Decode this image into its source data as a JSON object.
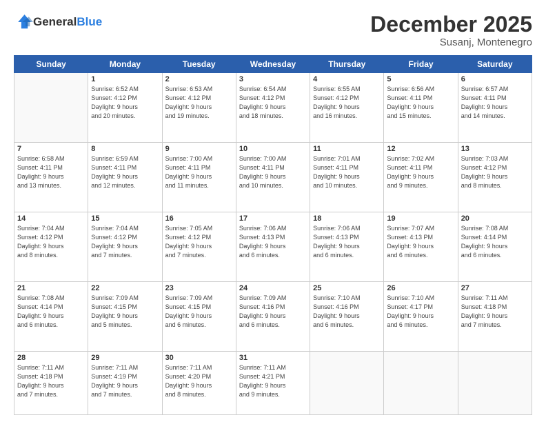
{
  "header": {
    "logo_general": "General",
    "logo_blue": "Blue",
    "month_year": "December 2025",
    "location": "Susanj, Montenegro"
  },
  "days_of_week": [
    "Sunday",
    "Monday",
    "Tuesday",
    "Wednesday",
    "Thursday",
    "Friday",
    "Saturday"
  ],
  "weeks": [
    [
      {
        "day": "",
        "info": ""
      },
      {
        "day": "1",
        "info": "Sunrise: 6:52 AM\nSunset: 4:12 PM\nDaylight: 9 hours\nand 20 minutes."
      },
      {
        "day": "2",
        "info": "Sunrise: 6:53 AM\nSunset: 4:12 PM\nDaylight: 9 hours\nand 19 minutes."
      },
      {
        "day": "3",
        "info": "Sunrise: 6:54 AM\nSunset: 4:12 PM\nDaylight: 9 hours\nand 18 minutes."
      },
      {
        "day": "4",
        "info": "Sunrise: 6:55 AM\nSunset: 4:12 PM\nDaylight: 9 hours\nand 16 minutes."
      },
      {
        "day": "5",
        "info": "Sunrise: 6:56 AM\nSunset: 4:11 PM\nDaylight: 9 hours\nand 15 minutes."
      },
      {
        "day": "6",
        "info": "Sunrise: 6:57 AM\nSunset: 4:11 PM\nDaylight: 9 hours\nand 14 minutes."
      }
    ],
    [
      {
        "day": "7",
        "info": "Sunrise: 6:58 AM\nSunset: 4:11 PM\nDaylight: 9 hours\nand 13 minutes."
      },
      {
        "day": "8",
        "info": "Sunrise: 6:59 AM\nSunset: 4:11 PM\nDaylight: 9 hours\nand 12 minutes."
      },
      {
        "day": "9",
        "info": "Sunrise: 7:00 AM\nSunset: 4:11 PM\nDaylight: 9 hours\nand 11 minutes."
      },
      {
        "day": "10",
        "info": "Sunrise: 7:00 AM\nSunset: 4:11 PM\nDaylight: 9 hours\nand 10 minutes."
      },
      {
        "day": "11",
        "info": "Sunrise: 7:01 AM\nSunset: 4:11 PM\nDaylight: 9 hours\nand 10 minutes."
      },
      {
        "day": "12",
        "info": "Sunrise: 7:02 AM\nSunset: 4:11 PM\nDaylight: 9 hours\nand 9 minutes."
      },
      {
        "day": "13",
        "info": "Sunrise: 7:03 AM\nSunset: 4:12 PM\nDaylight: 9 hours\nand 8 minutes."
      }
    ],
    [
      {
        "day": "14",
        "info": "Sunrise: 7:04 AM\nSunset: 4:12 PM\nDaylight: 9 hours\nand 8 minutes."
      },
      {
        "day": "15",
        "info": "Sunrise: 7:04 AM\nSunset: 4:12 PM\nDaylight: 9 hours\nand 7 minutes."
      },
      {
        "day": "16",
        "info": "Sunrise: 7:05 AM\nSunset: 4:12 PM\nDaylight: 9 hours\nand 7 minutes."
      },
      {
        "day": "17",
        "info": "Sunrise: 7:06 AM\nSunset: 4:13 PM\nDaylight: 9 hours\nand 6 minutes."
      },
      {
        "day": "18",
        "info": "Sunrise: 7:06 AM\nSunset: 4:13 PM\nDaylight: 9 hours\nand 6 minutes."
      },
      {
        "day": "19",
        "info": "Sunrise: 7:07 AM\nSunset: 4:13 PM\nDaylight: 9 hours\nand 6 minutes."
      },
      {
        "day": "20",
        "info": "Sunrise: 7:08 AM\nSunset: 4:14 PM\nDaylight: 9 hours\nand 6 minutes."
      }
    ],
    [
      {
        "day": "21",
        "info": "Sunrise: 7:08 AM\nSunset: 4:14 PM\nDaylight: 9 hours\nand 6 minutes."
      },
      {
        "day": "22",
        "info": "Sunrise: 7:09 AM\nSunset: 4:15 PM\nDaylight: 9 hours\nand 5 minutes."
      },
      {
        "day": "23",
        "info": "Sunrise: 7:09 AM\nSunset: 4:15 PM\nDaylight: 9 hours\nand 6 minutes."
      },
      {
        "day": "24",
        "info": "Sunrise: 7:09 AM\nSunset: 4:16 PM\nDaylight: 9 hours\nand 6 minutes."
      },
      {
        "day": "25",
        "info": "Sunrise: 7:10 AM\nSunset: 4:16 PM\nDaylight: 9 hours\nand 6 minutes."
      },
      {
        "day": "26",
        "info": "Sunrise: 7:10 AM\nSunset: 4:17 PM\nDaylight: 9 hours\nand 6 minutes."
      },
      {
        "day": "27",
        "info": "Sunrise: 7:11 AM\nSunset: 4:18 PM\nDaylight: 9 hours\nand 7 minutes."
      }
    ],
    [
      {
        "day": "28",
        "info": "Sunrise: 7:11 AM\nSunset: 4:18 PM\nDaylight: 9 hours\nand 7 minutes."
      },
      {
        "day": "29",
        "info": "Sunrise: 7:11 AM\nSunset: 4:19 PM\nDaylight: 9 hours\nand 7 minutes."
      },
      {
        "day": "30",
        "info": "Sunrise: 7:11 AM\nSunset: 4:20 PM\nDaylight: 9 hours\nand 8 minutes."
      },
      {
        "day": "31",
        "info": "Sunrise: 7:11 AM\nSunset: 4:21 PM\nDaylight: 9 hours\nand 9 minutes."
      },
      {
        "day": "",
        "info": ""
      },
      {
        "day": "",
        "info": ""
      },
      {
        "day": "",
        "info": ""
      }
    ]
  ]
}
